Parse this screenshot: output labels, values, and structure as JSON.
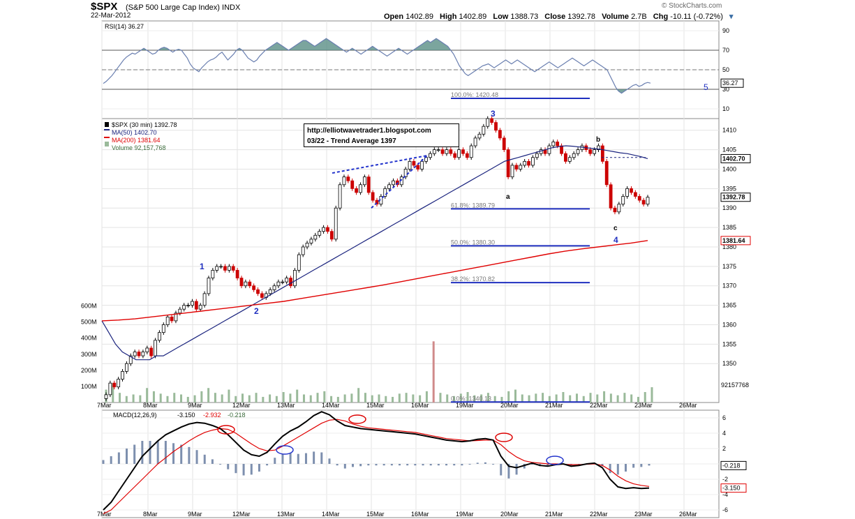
{
  "header": {
    "symbol": "$SPX",
    "name": "(S&P 500 Large Cap Index)",
    "exchange": "INDX",
    "date": "22-Mar-2012",
    "brand": "© StockCharts.com",
    "open_label": "Open",
    "open": "1402.89",
    "high_label": "High",
    "high": "1402.89",
    "low_label": "Low",
    "low": "1388.73",
    "close_label": "Close",
    "close": "1392.78",
    "volume_label": "Volume",
    "volume": "2.7B",
    "chg_label": "Chg",
    "chg": "-10.11 (-0.72%)"
  },
  "annotation_box": {
    "line1": "http://elliotwavetrader1.blogspot.com",
    "line2": "03/22 - Trend Average 1397"
  },
  "colors": {
    "up_candle": "#000000",
    "down_candle": "#cc0000",
    "ma50": "#1a237e",
    "ma200": "#e00000",
    "wave_labels": "#1f2fbf",
    "fib_lines": "#1f2fbf",
    "rsi_fill": "#5a8f86",
    "volume_bar": "#9aba9a",
    "macd_line": "#000000",
    "signal_line": "#e00000",
    "histogram": "#7d8fae"
  },
  "chart_data": [
    {
      "type": "line",
      "panel": "rsi",
      "legend": "RSI(14) 36.27",
      "last_value": 36.27,
      "y_ticks": [
        10,
        30,
        50,
        70,
        90
      ],
      "ylim": [
        0,
        100
      ],
      "overbought": 70,
      "oversold": 30,
      "midline": 50,
      "fib_labels": [
        "100.0%: 1420.48"
      ],
      "wave_label_right": "5",
      "values": [
        36,
        38,
        41,
        44,
        48,
        52,
        56,
        60,
        63,
        65,
        67,
        66,
        68,
        70,
        72,
        70,
        68,
        66,
        67,
        70,
        72,
        73,
        72,
        70,
        68,
        70,
        71,
        70,
        66,
        62,
        56,
        52,
        50,
        48,
        52,
        55,
        58,
        60,
        61,
        63,
        66,
        68,
        64,
        60,
        63,
        66,
        70,
        72,
        70,
        66,
        62,
        60,
        58,
        60,
        64,
        67,
        70,
        72,
        74,
        76,
        78,
        76,
        74,
        72,
        70,
        72,
        74,
        76,
        78,
        80,
        80,
        78,
        76,
        74,
        76,
        78,
        80,
        82,
        80,
        78,
        76,
        74,
        72,
        70,
        68,
        70,
        72,
        70,
        68,
        66,
        68,
        70,
        72,
        74,
        72,
        70,
        68,
        66,
        64,
        66,
        68,
        70,
        72,
        70,
        68,
        66,
        68,
        70,
        72,
        74,
        76,
        78,
        80,
        78,
        80,
        82,
        80,
        78,
        76,
        74,
        70,
        66,
        60,
        54,
        50,
        46,
        44,
        46,
        48,
        50,
        52,
        54,
        55,
        56,
        54,
        52,
        54,
        56,
        58,
        60,
        58,
        56,
        58,
        60,
        58,
        56,
        54,
        52,
        50,
        48,
        50,
        52,
        54,
        56,
        58,
        56,
        54,
        52,
        54,
        56,
        58,
        60,
        62,
        60,
        58,
        56,
        54,
        56,
        58,
        60,
        58,
        56,
        54,
        52,
        50,
        44,
        38,
        32,
        28,
        26,
        28,
        30,
        32,
        34,
        35,
        33,
        34,
        36,
        37,
        36.27
      ]
    },
    {
      "type": "candlestick",
      "panel": "price",
      "legend": [
        "$SPX (30 min) 1392.78",
        "MA(50) 1402.70",
        "MA(200) 1381.64",
        "Volume 92,157,768"
      ],
      "x_tick_labels": [
        "7Mar",
        "8Mar",
        "9Mar",
        "12Mar",
        "13Mar",
        "14Mar",
        "15Mar",
        "16Mar",
        "19Mar",
        "20Mar",
        "21Mar",
        "22Mar",
        "23Mar",
        "26Mar"
      ],
      "y_ticks": [
        1350,
        1355,
        1360,
        1365,
        1370,
        1375,
        1380,
        1385,
        1390,
        1395,
        1400,
        1405,
        1410
      ],
      "ylim": [
        1340,
        1413
      ],
      "right_value_labels": [
        "1402.70",
        "1392.78",
        "1381.64",
        "92157768"
      ],
      "volume_ticks": [
        "100M",
        "200M",
        "300M",
        "400M",
        "500M",
        "600M"
      ],
      "fib_levels": [
        {
          "label": "61.8%: 1389.79",
          "value": 1389.79
        },
        {
          "label": "50.0%: 1380.30",
          "value": 1380.3
        },
        {
          "label": "38.2%: 1370.82",
          "value": 1370.82
        },
        {
          "label": "0.0%: 1340.13",
          "value": 1340.13
        }
      ],
      "wave_labels": [
        "1",
        "2",
        "3",
        "4",
        "a",
        "b",
        "c"
      ],
      "closes": [
        1342,
        1345,
        1344,
        1346,
        1348,
        1350,
        1352,
        1353,
        1352,
        1353,
        1354,
        1352,
        1356,
        1358,
        1360,
        1362,
        1361,
        1363,
        1364,
        1365,
        1365,
        1366,
        1364,
        1365,
        1368,
        1372,
        1374,
        1375,
        1375,
        1374,
        1375,
        1374,
        1372,
        1370,
        1371,
        1370,
        1369,
        1368,
        1367,
        1368,
        1369,
        1370,
        1371,
        1371,
        1372,
        1370,
        1374,
        1378,
        1380,
        1381,
        1382,
        1383,
        1384,
        1385,
        1384,
        1382,
        1390,
        1396,
        1398,
        1397,
        1395,
        1394,
        1396,
        1398,
        1394,
        1392,
        1391,
        1393,
        1395,
        1396,
        1397,
        1396,
        1398,
        1400,
        1402,
        1401,
        1400,
        1402,
        1403,
        1404,
        1405,
        1405,
        1404,
        1405,
        1404,
        1403,
        1405,
        1404,
        1403,
        1406,
        1408,
        1409,
        1411,
        1413,
        1412,
        1410,
        1408,
        1405,
        1398,
        1401,
        1400,
        1401,
        1402,
        1401,
        1403,
        1404,
        1405,
        1404,
        1406,
        1407,
        1406,
        1404,
        1402,
        1403,
        1404,
        1405,
        1406,
        1405,
        1404,
        1405,
        1406,
        1402,
        1396,
        1390,
        1389,
        1391,
        1393,
        1395,
        1394,
        1393,
        1392,
        1391,
        1392.78
      ],
      "ma50": [
        1361,
        1358,
        1355,
        1353,
        1352,
        1351,
        1351,
        1351,
        1352,
        1352,
        1353,
        1354,
        1355,
        1356,
        1357,
        1358,
        1359,
        1360,
        1361,
        1362,
        1363,
        1364,
        1365,
        1366,
        1367,
        1368,
        1369,
        1370,
        1371,
        1372,
        1373,
        1374,
        1375,
        1376,
        1377,
        1378,
        1379,
        1380,
        1381,
        1382,
        1383,
        1384,
        1385,
        1386,
        1387,
        1388,
        1389,
        1390,
        1391,
        1392,
        1393,
        1394,
        1395,
        1396,
        1397,
        1398,
        1399,
        1400,
        1401,
        1402,
        1402.5,
        1403,
        1403.5,
        1404,
        1404.5,
        1405,
        1405.5,
        1405.8,
        1406,
        1405.9,
        1405.7,
        1405.5,
        1405.3,
        1405.1,
        1404.8,
        1404.5,
        1404.2,
        1404,
        1403.6,
        1403.2,
        1402.7
      ],
      "ma200": [
        1361,
        1361.2,
        1361.5,
        1362,
        1362.5,
        1363,
        1363.5,
        1364,
        1364.5,
        1365,
        1365.5,
        1366,
        1366.7,
        1367.4,
        1368.1,
        1368.8,
        1369.5,
        1370.2,
        1371,
        1371.8,
        1372.6,
        1373.4,
        1374.2,
        1375,
        1375.8,
        1376.6,
        1377.4,
        1378.2,
        1378.9,
        1379.5,
        1380,
        1380.5,
        1381,
        1381.64
      ],
      "volume_millions": [
        80,
        120,
        60,
        40,
        50,
        45,
        90,
        70,
        55,
        40,
        60,
        50,
        35,
        45,
        70,
        90,
        60,
        50,
        80,
        40,
        55,
        45,
        60,
        35,
        50,
        40,
        65,
        55,
        80,
        50,
        45,
        60,
        70,
        40,
        35,
        50,
        55,
        90,
        60,
        45,
        50,
        40,
        35,
        55,
        60,
        50,
        45,
        70,
        380,
        60,
        50,
        40,
        55,
        65,
        45,
        50,
        60,
        40,
        35,
        70,
        80,
        50,
        45,
        55,
        60,
        40,
        50,
        65,
        45,
        55,
        40,
        60,
        50,
        70,
        55,
        45,
        60,
        50,
        35,
        65,
        95
      ]
    },
    {
      "type": "line",
      "panel": "macd",
      "legend_name": "MACD(12,26,9)",
      "legend_values": [
        "-3.150",
        "-2.932",
        "-0.218"
      ],
      "y_ticks": [
        -6,
        -4,
        -2,
        0,
        2,
        4,
        6
      ],
      "ylim": [
        -7,
        7
      ],
      "right_value_labels": [
        "-0.218",
        "-3.150"
      ],
      "x_tick_labels": [
        "7Mar",
        "8Mar",
        "9Mar",
        "12Mar",
        "13Mar",
        "14Mar",
        "15Mar",
        "16Mar",
        "19Mar",
        "20Mar",
        "21Mar",
        "22Mar",
        "23Mar",
        "26Mar"
      ],
      "series": [
        {
          "name": "MACD",
          "values": [
            -6,
            -5,
            -3.5,
            -2,
            -0.5,
            1,
            2,
            3,
            3.8,
            4.3,
            4.8,
            5.2,
            5.4,
            5.3,
            5.0,
            4.6,
            3.8,
            2.8,
            1.8,
            1.2,
            1.0,
            1.5,
            2.6,
            3.6,
            4.3,
            4.8,
            5.5,
            6.3,
            6.8,
            6.4,
            5.6,
            5.0,
            4.8,
            4.6,
            4.5,
            4.4,
            4.3,
            4.2,
            4.1,
            4.0,
            3.9,
            3.7,
            3.5,
            3.3,
            3.1,
            3.0,
            2.9,
            3.0,
            3.2,
            3.3,
            3.1,
            1.0,
            -0.3,
            -0.5,
            -0.2,
            0.1,
            -0.2,
            -0.3,
            -0.1,
            0.0,
            -0.3,
            -0.2,
            0.0,
            0.1,
            -0.5,
            -2.0,
            -3.0,
            -3.2,
            -3.1,
            -3.2,
            -3.15
          ]
        },
        {
          "name": "Signal",
          "values": [
            -6.5,
            -6,
            -5,
            -4,
            -3,
            -2,
            -1,
            0,
            0.8,
            1.6,
            2.3,
            3.0,
            3.6,
            4.1,
            4.4,
            4.6,
            4.5,
            4.0,
            3.3,
            2.6,
            2.0,
            1.7,
            1.8,
            2.3,
            2.9,
            3.5,
            4.1,
            4.7,
            5.3,
            5.7,
            5.8,
            5.6,
            5.2,
            4.9,
            4.7,
            4.6,
            4.5,
            4.4,
            4.3,
            4.2,
            4.1,
            3.9,
            3.7,
            3.5,
            3.3,
            3.2,
            3.1,
            3.0,
            3.05,
            3.1,
            3.1,
            2.5,
            1.6,
            0.9,
            0.4,
            0.2,
            0.1,
            0.0,
            0.0,
            -0.05,
            -0.1,
            -0.1,
            -0.05,
            0.0,
            -0.2,
            -0.8,
            -1.6,
            -2.2,
            -2.6,
            -2.8,
            -2.932
          ]
        },
        {
          "name": "Histogram",
          "values": [
            0.5,
            1.0,
            1.5,
            2.0,
            2.5,
            3.0,
            3.0,
            3.0,
            3.0,
            2.7,
            2.5,
            2.2,
            1.8,
            1.2,
            0.6,
            0.0,
            -0.7,
            -1.2,
            -1.5,
            -1.4,
            -1.0,
            -0.2,
            0.8,
            1.3,
            1.4,
            1.3,
            1.4,
            1.6,
            1.5,
            0.7,
            -0.2,
            -0.6,
            -0.4,
            -0.3,
            -0.2,
            -0.2,
            -0.2,
            -0.2,
            -0.2,
            -0.2,
            -0.2,
            -0.2,
            -0.2,
            -0.2,
            -0.2,
            -0.2,
            -0.2,
            0.0,
            0.15,
            0.2,
            0.0,
            -1.5,
            -1.9,
            -1.4,
            -0.6,
            -0.1,
            -0.3,
            -0.3,
            -0.1,
            0.05,
            -0.2,
            -0.1,
            0.05,
            0.1,
            -0.3,
            -1.2,
            -1.4,
            -1.0,
            -0.5,
            -0.4,
            -0.218
          ]
        }
      ]
    }
  ]
}
